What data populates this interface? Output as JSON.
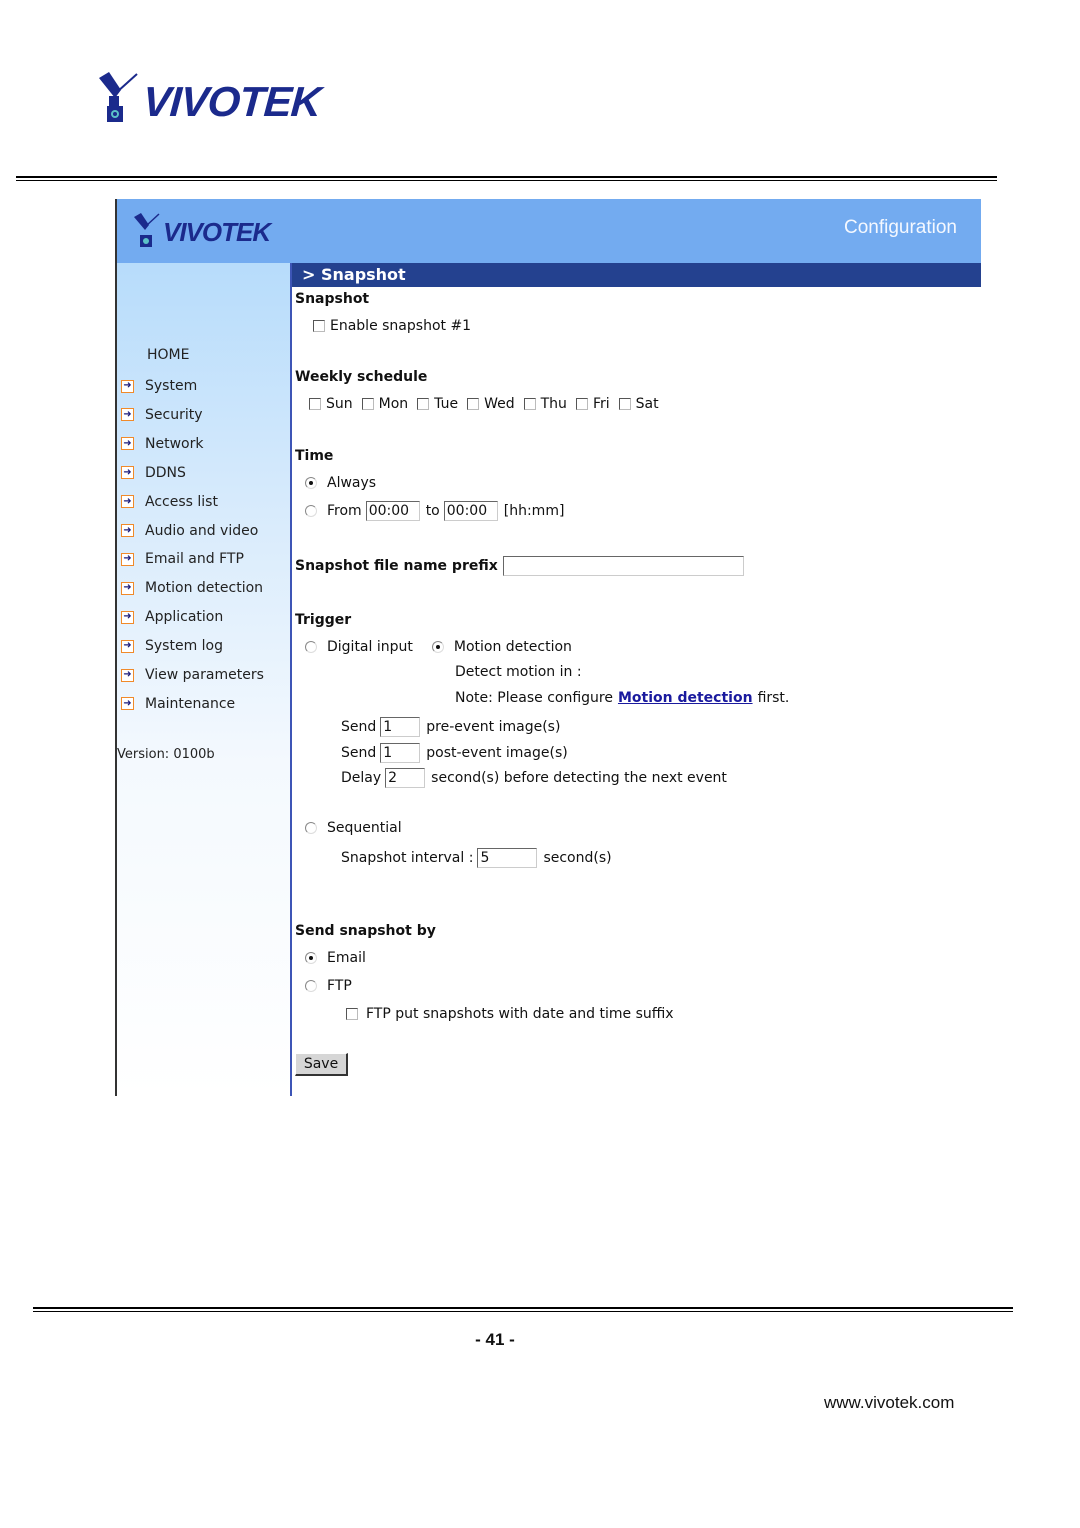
{
  "page": {
    "brand": "VIVOTEK",
    "page_number": "- 41 -",
    "website": "www.vivotek.com"
  },
  "ui": {
    "brand": "VIVOTEK",
    "header_title": "Configuration",
    "colors": {
      "header_bg": "#73abf0",
      "titlebar_bg": "#24418f",
      "link": "#1a1a9e",
      "nav_arrow_border": "#f08a2a"
    },
    "sidebar": {
      "home": "HOME",
      "items": [
        {
          "label": "System",
          "icon": "arrow-right-icon"
        },
        {
          "label": "Security",
          "icon": "arrow-right-icon"
        },
        {
          "label": "Network",
          "icon": "arrow-right-icon"
        },
        {
          "label": "DDNS",
          "icon": "arrow-right-icon"
        },
        {
          "label": "Access list",
          "icon": "arrow-right-icon"
        },
        {
          "label": "Audio and video",
          "icon": "arrow-right-icon"
        },
        {
          "label": "Email and FTP",
          "icon": "arrow-right-icon"
        },
        {
          "label": "Motion detection",
          "icon": "arrow-right-icon"
        },
        {
          "label": "Application",
          "icon": "arrow-right-icon"
        },
        {
          "label": "System log",
          "icon": "arrow-right-icon"
        },
        {
          "label": "View parameters",
          "icon": "arrow-right-icon"
        },
        {
          "label": "Maintenance",
          "icon": "arrow-right-icon"
        }
      ],
      "version": "Version: 0100b"
    },
    "titlebar": "> Snapshot",
    "snapshot": {
      "title": "Snapshot",
      "enable_label": "Enable snapshot #1",
      "enable_checked": false
    },
    "weekly": {
      "title": "Weekly schedule",
      "days": [
        {
          "label": "Sun",
          "checked": false
        },
        {
          "label": "Mon",
          "checked": false
        },
        {
          "label": "Tue",
          "checked": false
        },
        {
          "label": "Wed",
          "checked": false
        },
        {
          "label": "Thu",
          "checked": false
        },
        {
          "label": "Fri",
          "checked": false
        },
        {
          "label": "Sat",
          "checked": false
        }
      ]
    },
    "time": {
      "title": "Time",
      "always_label": "Always",
      "always_selected": true,
      "from_label": "From",
      "from_value": "00:00",
      "to_label": "to",
      "to_value": "00:00",
      "format_hint": "[hh:mm]"
    },
    "prefix": {
      "label": "Snapshot file name prefix",
      "value": ""
    },
    "trigger": {
      "title": "Trigger",
      "digital_input_label": "Digital input",
      "motion_label": "Motion detection",
      "selected": "Motion detection",
      "detect_in_label": "Detect motion in :",
      "note_prefix": "Note: Please configure",
      "note_link": "Motion detection",
      "note_suffix": "first.",
      "pre_send_label": "Send",
      "pre_value": "1",
      "pre_suffix": "pre-event image(s)",
      "post_send_label": "Send",
      "post_value": "1",
      "post_suffix": "post-event image(s)",
      "delay_label": "Delay",
      "delay_value": "2",
      "delay_suffix": "second(s) before detecting the next event",
      "sequential_label": "Sequential",
      "interval_label": "Snapshot interval :",
      "interval_value": "5",
      "interval_suffix": "second(s)"
    },
    "send_by": {
      "title": "Send snapshot by",
      "email_label": "Email",
      "ftp_label": "FTP",
      "selected": "Email",
      "ftp_suffix_label": "FTP put snapshots with date and time suffix",
      "ftp_suffix_checked": false
    },
    "save_label": "Save"
  }
}
